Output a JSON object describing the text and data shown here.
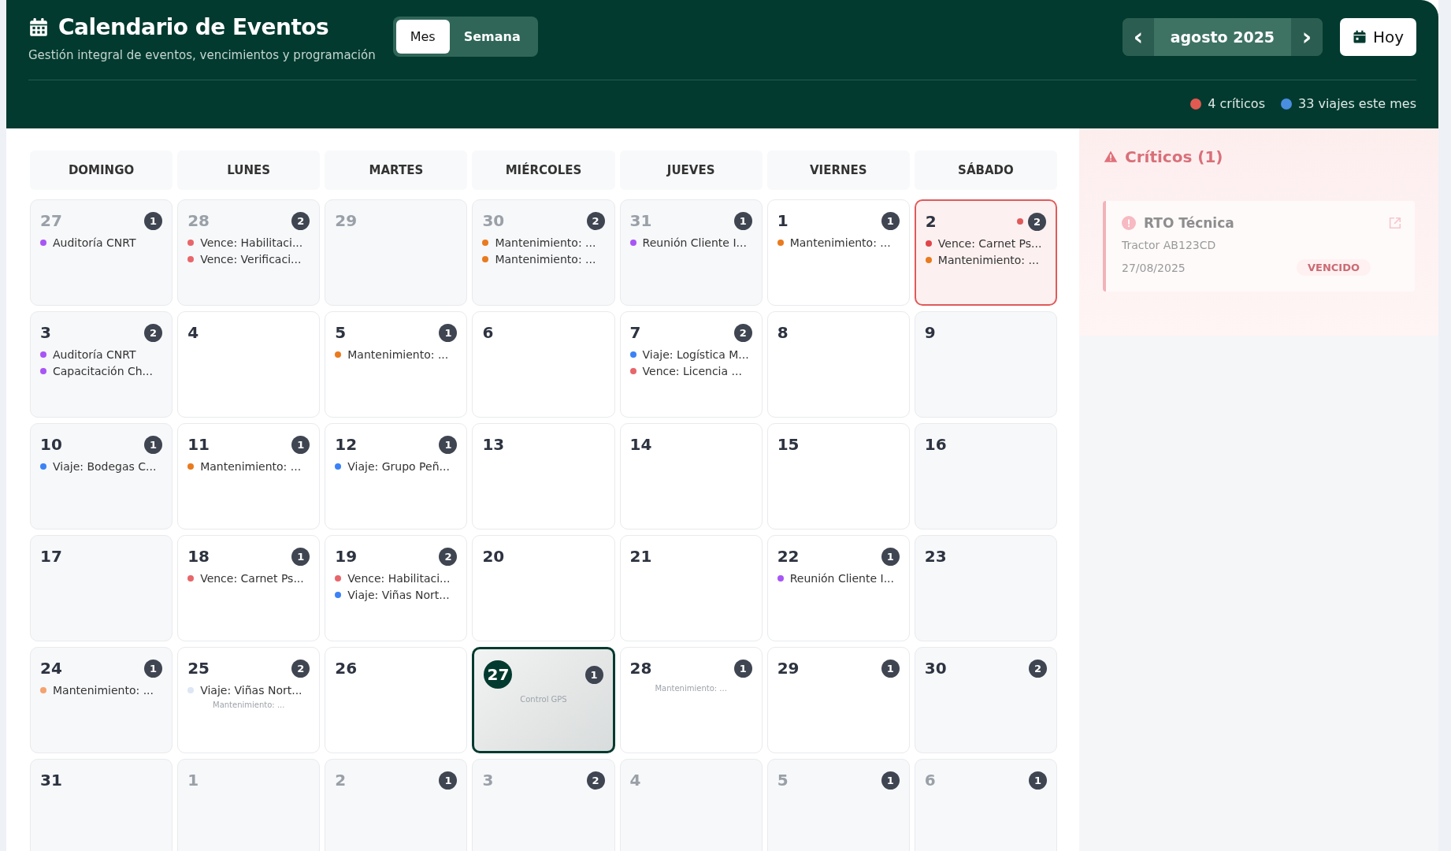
{
  "header": {
    "title": "Calendario de Eventos",
    "subtitle": "Gestión integral de eventos, vencimientos y programación",
    "views": [
      {
        "label": "Mes",
        "selected": true
      },
      {
        "label": "Semana",
        "selected": false
      }
    ],
    "prev": "‹",
    "month": "agosto 2025",
    "next": "›",
    "today_button": "Hoy",
    "stats": [
      {
        "text": "4 críticos",
        "color": "#e05a52"
      },
      {
        "text": "33 viajes este mes",
        "color": "#4a8ee0"
      }
    ]
  },
  "weekdays": [
    "DOMINGO",
    "LUNES",
    "MARTES",
    "MIÉRCOLES",
    "JUEVES",
    "VIERNES",
    "SÁBADO"
  ],
  "weeks": [
    [
      {
        "day": "27",
        "in_month": false,
        "selected": false,
        "today": false,
        "critical": false,
        "count": "1",
        "events": [
          {
            "text": "Auditoría CNRT",
            "color": "#a855f7"
          }
        ]
      },
      {
        "day": "28",
        "in_month": false,
        "selected": false,
        "today": false,
        "critical": false,
        "count": "2",
        "events": [
          {
            "text": "Vence: Habilitaci...",
            "color": "#e8666a"
          },
          {
            "text": "Vence: Verificaci...",
            "color": "#e8666a"
          }
        ]
      },
      {
        "day": "29",
        "in_month": false,
        "selected": false,
        "today": false,
        "critical": false
      },
      {
        "day": "30",
        "in_month": false,
        "selected": false,
        "today": false,
        "critical": false,
        "count": "2",
        "events": [
          {
            "text": "Mantenimiento: ...",
            "color": "#ea7a1e"
          },
          {
            "text": "Mantenimiento: ...",
            "color": "#ea7a1e"
          }
        ]
      },
      {
        "day": "31",
        "in_month": false,
        "selected": false,
        "today": false,
        "critical": false,
        "count": "1",
        "events": [
          {
            "text": "Reunión Cliente I...",
            "color": "#a855f7"
          }
        ]
      },
      {
        "day": "1",
        "in_month": true,
        "selected": false,
        "today": false,
        "critical": false,
        "count": "1",
        "events": [
          {
            "text": "Mantenimiento: ...",
            "color": "#ea7a1e"
          }
        ]
      },
      {
        "day": "2",
        "in_month": true,
        "selected": true,
        "today": false,
        "critical": true,
        "count": "2",
        "events": [
          {
            "text": "Vence: Carnet Ps...",
            "color": "#e0454a"
          },
          {
            "text": "Mantenimiento: ...",
            "color": "#ea7a1e"
          }
        ]
      }
    ],
    [
      {
        "day": "3",
        "in_month": true,
        "selected": false,
        "today": false,
        "critical": false,
        "count": "2",
        "events": [
          {
            "text": "Auditoría CNRT",
            "color": "#a855f7"
          },
          {
            "text": "Capacitación Ch...",
            "color": "#a855f7"
          }
        ]
      },
      {
        "day": "4",
        "in_month": true,
        "selected": false,
        "today": false,
        "critical": false
      },
      {
        "day": "5",
        "in_month": true,
        "selected": false,
        "today": false,
        "critical": false,
        "count": "1",
        "events": [
          {
            "text": "Mantenimiento: ...",
            "color": "#ea7a1e"
          }
        ]
      },
      {
        "day": "6",
        "in_month": true,
        "selected": false,
        "today": false,
        "critical": false
      },
      {
        "day": "7",
        "in_month": true,
        "selected": false,
        "today": false,
        "critical": false,
        "count": "2",
        "events": [
          {
            "text": "Viaje: Logística M...",
            "color": "#3b82f6"
          },
          {
            "text": "Vence: Licencia ...",
            "color": "#e8666a"
          }
        ]
      },
      {
        "day": "8",
        "in_month": true,
        "selected": false,
        "today": false,
        "critical": false
      },
      {
        "day": "9",
        "in_month": true,
        "selected": false,
        "today": false,
        "critical": false
      }
    ],
    [
      {
        "day": "10",
        "in_month": true,
        "selected": false,
        "today": false,
        "critical": false,
        "count": "1",
        "events": [
          {
            "text": "Viaje: Bodegas C...",
            "color": "#3b82f6"
          }
        ]
      },
      {
        "day": "11",
        "in_month": true,
        "selected": false,
        "today": false,
        "critical": false,
        "count": "1",
        "events": [
          {
            "text": "Mantenimiento: ...",
            "color": "#ea7a1e"
          }
        ]
      },
      {
        "day": "12",
        "in_month": true,
        "selected": false,
        "today": false,
        "critical": false,
        "count": "1",
        "events": [
          {
            "text": "Viaje: Grupo Peñ...",
            "color": "#3b82f6"
          }
        ]
      },
      {
        "day": "13",
        "in_month": true,
        "selected": false,
        "today": false,
        "critical": false
      },
      {
        "day": "14",
        "in_month": true,
        "selected": false,
        "today": false,
        "critical": false
      },
      {
        "day": "15",
        "in_month": true,
        "selected": false,
        "today": false,
        "critical": false
      },
      {
        "day": "16",
        "in_month": true,
        "selected": false,
        "today": false,
        "critical": false
      }
    ],
    [
      {
        "day": "17",
        "in_month": true,
        "selected": false,
        "today": false,
        "critical": false
      },
      {
        "day": "18",
        "in_month": true,
        "selected": false,
        "today": false,
        "critical": false,
        "count": "1",
        "events": [
          {
            "text": "Vence: Carnet Ps...",
            "color": "#e8666a"
          }
        ]
      },
      {
        "day": "19",
        "in_month": true,
        "selected": false,
        "today": false,
        "critical": false,
        "count": "2",
        "events": [
          {
            "text": "Vence: Habilitaci...",
            "color": "#e8666a"
          },
          {
            "text": "Viaje: Viñas Nort...",
            "color": "#3b82f6"
          }
        ]
      },
      {
        "day": "20",
        "in_month": true,
        "selected": false,
        "today": false,
        "critical": false
      },
      {
        "day": "21",
        "in_month": true,
        "selected": false,
        "today": false,
        "critical": false
      },
      {
        "day": "22",
        "in_month": true,
        "selected": false,
        "today": false,
        "critical": false,
        "count": "1",
        "events": [
          {
            "text": "Reunión Cliente I...",
            "color": "#a855f7"
          }
        ]
      },
      {
        "day": "23",
        "in_month": true,
        "selected": false,
        "today": false,
        "critical": false
      }
    ],
    [
      {
        "day": "24",
        "in_month": true,
        "selected": false,
        "today": false,
        "critical": false,
        "count": "1",
        "events": [
          {
            "text": "Mantenimiento: ...",
            "color": "#f4a26e"
          }
        ]
      },
      {
        "day": "25",
        "in_month": true,
        "selected": false,
        "today": false,
        "critical": false,
        "count": "2",
        "events": [
          {
            "text": "Viaje: Viñas Nort...",
            "color": "#dde6f5"
          },
          {
            "text": "Mantenimiento: ...",
            "faded": true
          }
        ]
      },
      {
        "day": "26",
        "in_month": true,
        "selected": false,
        "today": false,
        "critical": false
      },
      {
        "day": "27",
        "in_month": true,
        "selected": false,
        "today": true,
        "critical": false,
        "count": "1",
        "events": [
          {
            "text": "Control GPS",
            "faded": true
          }
        ]
      },
      {
        "day": "28",
        "in_month": true,
        "selected": false,
        "today": false,
        "critical": false,
        "count": "1",
        "events": [
          {
            "text": "Mantenimiento: ...",
            "faded": true
          }
        ]
      },
      {
        "day": "29",
        "in_month": true,
        "selected": false,
        "today": false,
        "critical": false,
        "count": "1"
      },
      {
        "day": "30",
        "in_month": true,
        "selected": false,
        "today": false,
        "critical": false,
        "count": "2"
      }
    ],
    [
      {
        "day": "31",
        "in_month": true,
        "selected": false,
        "today": false,
        "critical": false
      },
      {
        "day": "1",
        "in_month": false,
        "selected": false,
        "today": false,
        "critical": false
      },
      {
        "day": "2",
        "in_month": false,
        "selected": false,
        "today": false,
        "critical": false,
        "count": "1"
      },
      {
        "day": "3",
        "in_month": false,
        "selected": false,
        "today": false,
        "critical": false,
        "count": "2"
      },
      {
        "day": "4",
        "in_month": false,
        "selected": false,
        "today": false,
        "critical": false
      },
      {
        "day": "5",
        "in_month": false,
        "selected": false,
        "today": false,
        "critical": false,
        "count": "1"
      },
      {
        "day": "6",
        "in_month": false,
        "selected": false,
        "today": false,
        "critical": false,
        "count": "1"
      }
    ]
  ],
  "critical_panel": {
    "title": "Críticos (1)",
    "items": [
      {
        "title": "RTO Técnica",
        "vehicle": "Tractor AB123CD",
        "date": "27/08/2025",
        "status": "VENCIDO"
      }
    ]
  }
}
